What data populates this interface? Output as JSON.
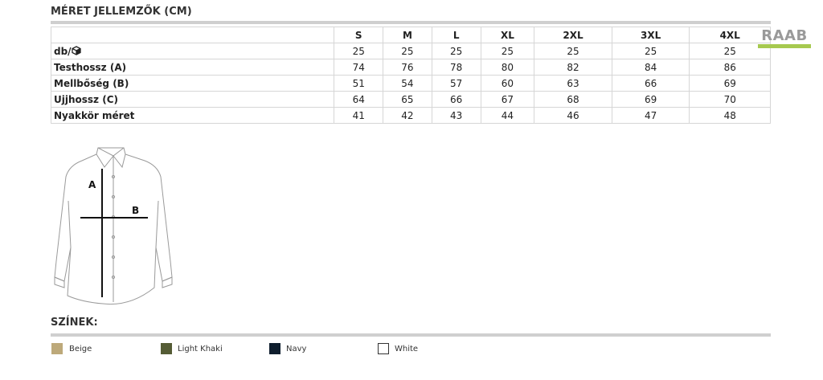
{
  "size_chart": {
    "title": "MÉRET JELLEMZŐK (CM)",
    "sizes": [
      "S",
      "M",
      "L",
      "XL",
      "2XL",
      "3XL",
      "4XL"
    ],
    "rows": [
      {
        "label": "db/",
        "values": [
          "25",
          "25",
          "25",
          "25",
          "25",
          "25",
          "25"
        ]
      },
      {
        "label": "Testhossz (A)",
        "values": [
          "74",
          "76",
          "78",
          "80",
          "82",
          "84",
          "86"
        ]
      },
      {
        "label": "Mellbőség (B)",
        "values": [
          "51",
          "54",
          "57",
          "60",
          "63",
          "66",
          "69"
        ]
      },
      {
        "label": "Ujjhossz (C)",
        "values": [
          "64",
          "65",
          "66",
          "67",
          "68",
          "69",
          "70"
        ]
      },
      {
        "label": "Nyakkör méret",
        "values": [
          "41",
          "42",
          "43",
          "44",
          "46",
          "47",
          "48"
        ]
      }
    ]
  },
  "logo": {
    "text": "RAAB",
    "strip_color": "#a6c94f"
  },
  "diagram": {
    "label_a": "A",
    "label_b": "B"
  },
  "colors": {
    "title": "SZÍNEK:",
    "items": [
      {
        "label": "Beige",
        "hex": "#bda97a"
      },
      {
        "label": "Light Khaki",
        "hex": "#555c35"
      },
      {
        "label": "Navy",
        "hex": "#0f1e2e"
      },
      {
        "label": "White",
        "hex": "#ffffff"
      }
    ]
  }
}
